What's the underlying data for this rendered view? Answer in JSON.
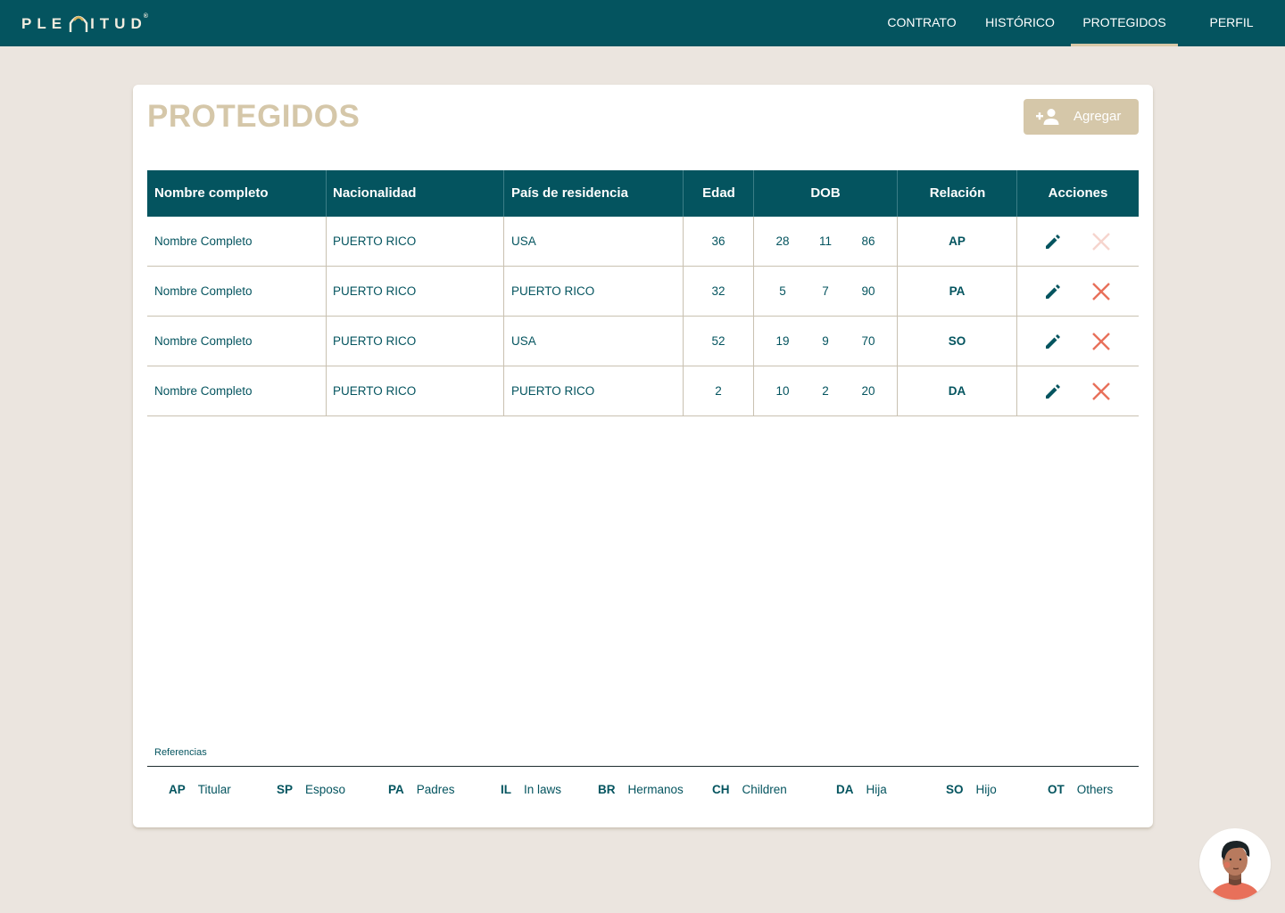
{
  "app": {
    "logo_text_left": "PLE",
    "logo_text_right": "ITUD",
    "logo_reg": "®"
  },
  "nav": {
    "items": [
      {
        "label": "CONTRATO",
        "active": false
      },
      {
        "label": "HISTÓRICO",
        "active": false
      },
      {
        "label": "PROTEGIDOS",
        "active": true
      },
      {
        "label": "PERFIL",
        "active": false
      }
    ]
  },
  "page": {
    "title": "PROTEGIDOS",
    "add_label": "Agregar"
  },
  "table": {
    "columns": [
      "Nombre  completo",
      "Nacionalidad",
      "País de residencia",
      "Edad",
      "DOB",
      "Relación",
      "Acciones"
    ],
    "rows": [
      {
        "name": "Nombre Completo",
        "nationality": "PUERTO RICO",
        "residence": "USA",
        "age": "36",
        "dob_d": "28",
        "dob_m": "11",
        "dob_y": "86",
        "relation": "AP",
        "delete_enabled": false
      },
      {
        "name": "Nombre Completo",
        "nationality": "PUERTO RICO",
        "residence": "PUERTO RICO",
        "age": "32",
        "dob_d": "5",
        "dob_m": "7",
        "dob_y": "90",
        "relation": "PA",
        "delete_enabled": true
      },
      {
        "name": "Nombre Completo",
        "nationality": "PUERTO RICO",
        "residence": "USA",
        "age": "52",
        "dob_d": "19",
        "dob_m": "9",
        "dob_y": "70",
        "relation": "SO",
        "delete_enabled": true
      },
      {
        "name": "Nombre Completo",
        "nationality": "PUERTO RICO",
        "residence": "PUERTO RICO",
        "age": "2",
        "dob_d": "10",
        "dob_m": "2",
        "dob_y": "20",
        "relation": "DA",
        "delete_enabled": true
      }
    ]
  },
  "references": {
    "label": "Referencias",
    "items": [
      {
        "code": "AP",
        "text": "Titular"
      },
      {
        "code": "SP",
        "text": "Esposo"
      },
      {
        "code": "PA",
        "text": "Padres"
      },
      {
        "code": "IL",
        "text": "In laws"
      },
      {
        "code": "BR",
        "text": "Hermanos"
      },
      {
        "code": "CH",
        "text": "Children"
      },
      {
        "code": "DA",
        "text": "Hija"
      },
      {
        "code": "SO",
        "text": "Hijo"
      },
      {
        "code": "OT",
        "text": "Others"
      }
    ]
  },
  "icons": {
    "add": "person-add-icon",
    "edit": "pencil-icon",
    "delete": "close-icon",
    "avatar": "user-avatar"
  },
  "colors": {
    "primary": "#04545f",
    "accent": "#d5c7a9",
    "danger": "#e8705a",
    "danger_disabled": "#f6d4cd",
    "background": "#ebe5df"
  }
}
